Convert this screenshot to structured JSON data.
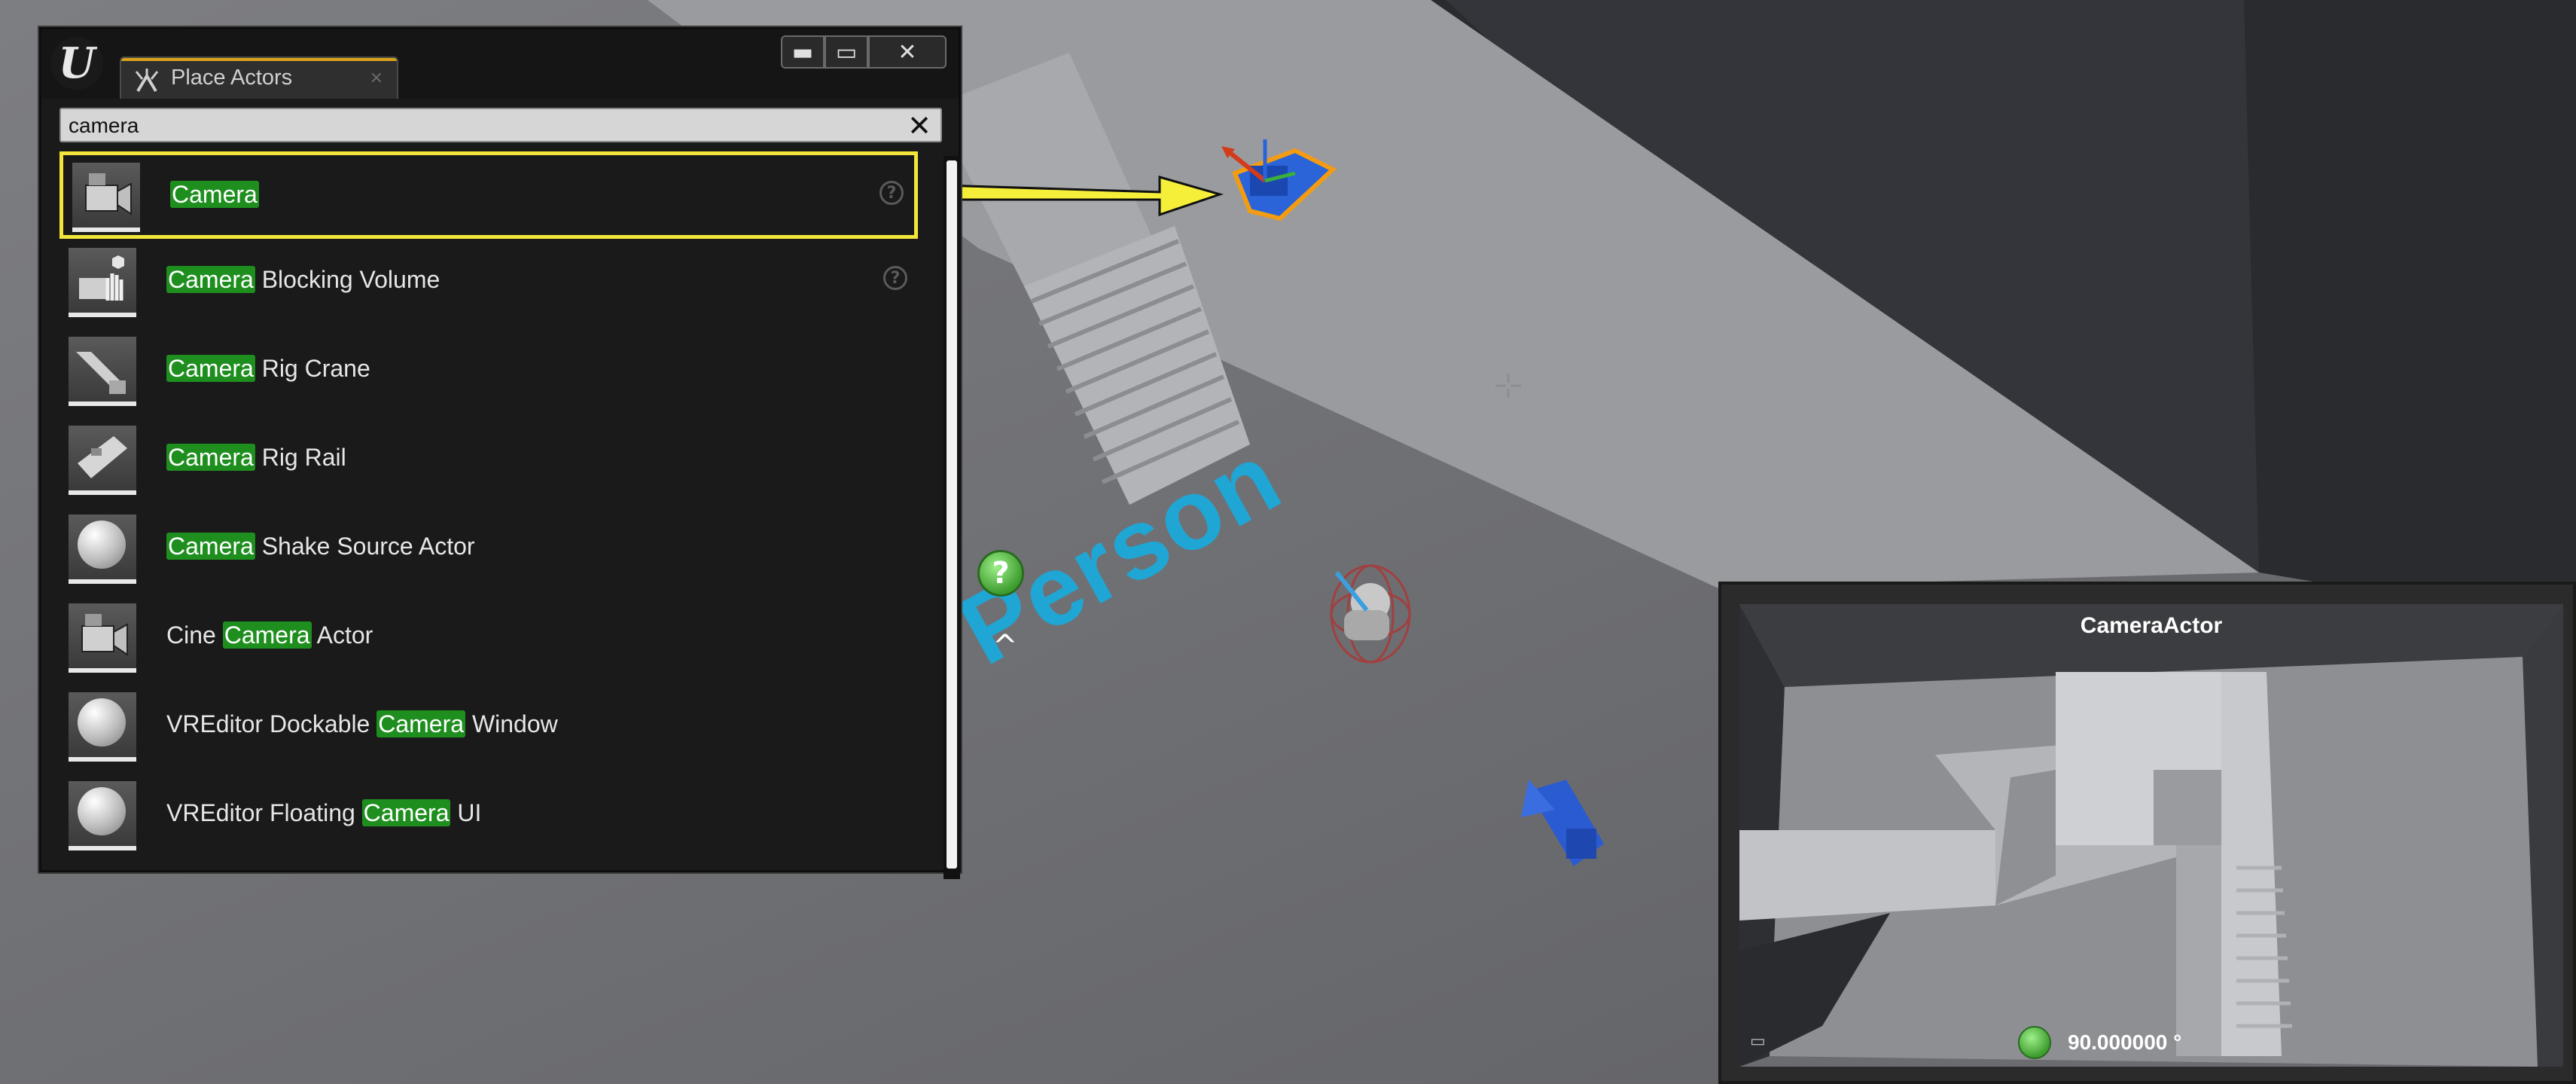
{
  "window": {
    "tab_label": "Place Actors",
    "tab_close": "×",
    "min_glyph": "▬",
    "max_glyph": "▭",
    "close_glyph": "✕",
    "logo_glyph": "U"
  },
  "search": {
    "value": "camera",
    "clear_glyph": "✕"
  },
  "items": [
    {
      "pre": "",
      "hl": "Camera",
      "post": "",
      "icon": "camera-icon",
      "help": true,
      "selected": true
    },
    {
      "pre": "",
      "hl": "Camera",
      "post": " Blocking Volume",
      "icon": "camera-blocking-volume-icon",
      "help": true,
      "selected": false
    },
    {
      "pre": "",
      "hl": "Camera",
      "post": " Rig Crane",
      "icon": "rig-crane-icon",
      "help": false,
      "selected": false
    },
    {
      "pre": "",
      "hl": "Camera",
      "post": " Rig Rail",
      "icon": "rig-rail-icon",
      "help": false,
      "selected": false
    },
    {
      "pre": "",
      "hl": "Camera",
      "post": " Shake Source Actor",
      "icon": "sphere-icon",
      "help": false,
      "selected": false
    },
    {
      "pre": "Cine ",
      "hl": "Camera",
      "post": " Actor",
      "icon": "cine-camera-icon",
      "help": false,
      "selected": false
    },
    {
      "pre": "VREditor Dockable ",
      "hl": "Camera",
      "post": " Window",
      "icon": "sphere-icon",
      "help": false,
      "selected": false
    },
    {
      "pre": "VREditor Floating ",
      "hl": "Camera",
      "post": " UI",
      "icon": "sphere-icon",
      "help": false,
      "selected": false
    }
  ],
  "help_glyph": "?",
  "viewport": {
    "text_actor": "Person",
    "help_marker": "?",
    "caret": "^"
  },
  "preview": {
    "title": "CameraActor",
    "fov": "90.000000 °"
  },
  "colors": {
    "highlight": "#1e8f1e",
    "selection": "#f2e63a",
    "arrow": "#f5ef3a",
    "text_actor": "#1fa6d4"
  }
}
